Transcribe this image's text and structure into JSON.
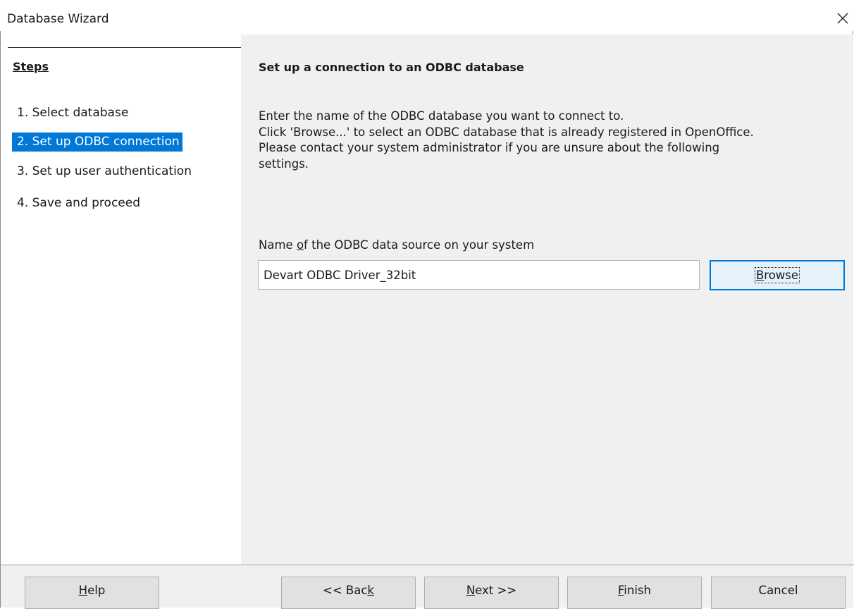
{
  "window": {
    "title": "Database Wizard",
    "close_icon": "close-icon"
  },
  "steps": {
    "title": "Steps",
    "items": [
      {
        "label": "1. Select database",
        "active": false
      },
      {
        "label": "2. Set up ODBC connection",
        "active": true
      },
      {
        "label": "3. Set up user authentication",
        "active": false
      },
      {
        "label": "4. Save and proceed",
        "active": false
      }
    ]
  },
  "content": {
    "heading": "Set up a connection to an ODBC database",
    "description": [
      "Enter the name of the ODBC database you want to connect to.",
      "Click 'Browse...' to select an ODBC database that is already registered in OpenOffice.",
      "Please contact your system administrator if you are unsure about the following",
      "settings."
    ],
    "field_label_pre": "Name ",
    "field_label_mnemonic": "o",
    "field_label_post": "f the ODBC data source on your system",
    "dsn_value": "Devart ODBC Driver_32bit",
    "browse_mnemonic": "B",
    "browse_rest": "rowse"
  },
  "buttons": {
    "help": {
      "mnemonic": "H",
      "rest": "elp"
    },
    "back": {
      "pre": "<< Bac",
      "mnemonic": "k"
    },
    "next": {
      "mnemonic": "N",
      "rest": "ext >>"
    },
    "finish": {
      "mnemonic": "F",
      "rest": "inish"
    },
    "cancel": {
      "label": "Cancel"
    }
  },
  "colors": {
    "accent": "#0078d7",
    "panel_bg": "#f0f0f0",
    "button_bg": "#e1e1e1"
  }
}
